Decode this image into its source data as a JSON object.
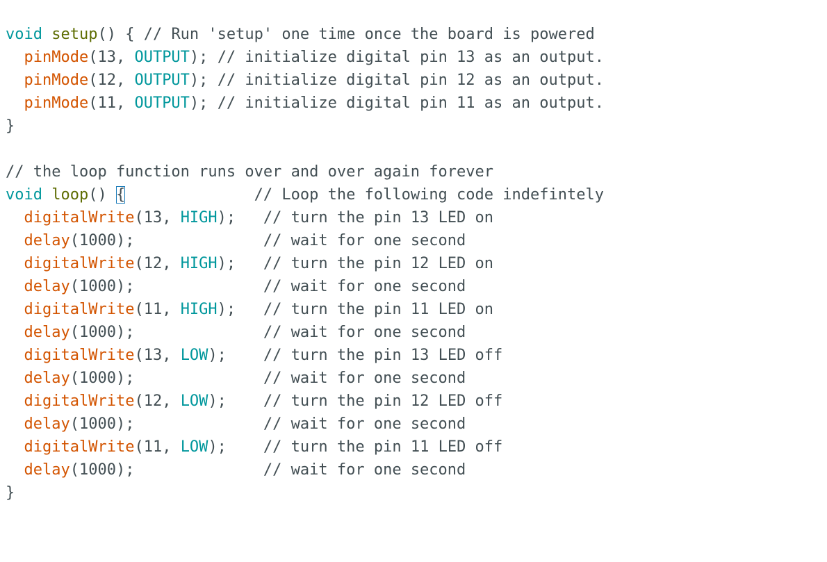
{
  "editor": {
    "lines": [
      {
        "parts": [
          [
            "kw",
            "void"
          ],
          [
            "plain",
            " "
          ],
          [
            "kw2",
            "setup"
          ],
          [
            "plain",
            "() { "
          ],
          [
            "cm",
            "// Run 'setup' one time once the board is powered"
          ]
        ]
      },
      {
        "parts": [
          [
            "plain",
            "  "
          ],
          [
            "fn",
            "pinMode"
          ],
          [
            "plain",
            "(13, "
          ],
          [
            "const",
            "OUTPUT"
          ],
          [
            "plain",
            "); "
          ],
          [
            "cm",
            "// initialize digital pin 13 as an output."
          ]
        ]
      },
      {
        "parts": [
          [
            "plain",
            "  "
          ],
          [
            "fn",
            "pinMode"
          ],
          [
            "plain",
            "(12, "
          ],
          [
            "const",
            "OUTPUT"
          ],
          [
            "plain",
            "); "
          ],
          [
            "cm",
            "// initialize digital pin 12 as an output."
          ]
        ]
      },
      {
        "parts": [
          [
            "plain",
            "  "
          ],
          [
            "fn",
            "pinMode"
          ],
          [
            "plain",
            "(11, "
          ],
          [
            "const",
            "OUTPUT"
          ],
          [
            "plain",
            "); "
          ],
          [
            "cm",
            "// initialize digital pin 11 as an output."
          ]
        ]
      },
      {
        "parts": [
          [
            "plain",
            "}"
          ]
        ]
      },
      {
        "parts": [
          [
            "plain",
            ""
          ]
        ]
      },
      {
        "parts": [
          [
            "cm",
            "// the loop function runs over and over again forever"
          ]
        ]
      },
      {
        "parts": [
          [
            "kw",
            "void"
          ],
          [
            "plain",
            " "
          ],
          [
            "kw2",
            "loop"
          ],
          [
            "plain",
            "() "
          ],
          [
            "brace",
            "{"
          ],
          [
            "plain",
            "              "
          ],
          [
            "cm",
            "// Loop the following code indefintely"
          ]
        ]
      },
      {
        "parts": [
          [
            "plain",
            "  "
          ],
          [
            "fn",
            "digitalWrite"
          ],
          [
            "plain",
            "(13, "
          ],
          [
            "const",
            "HIGH"
          ],
          [
            "plain",
            ");   "
          ],
          [
            "cm",
            "// turn the pin 13 LED on"
          ]
        ]
      },
      {
        "parts": [
          [
            "plain",
            "  "
          ],
          [
            "fn",
            "delay"
          ],
          [
            "plain",
            "(1000);              "
          ],
          [
            "cm",
            "// wait for one second"
          ]
        ]
      },
      {
        "parts": [
          [
            "plain",
            "  "
          ],
          [
            "fn",
            "digitalWrite"
          ],
          [
            "plain",
            "(12, "
          ],
          [
            "const",
            "HIGH"
          ],
          [
            "plain",
            ");   "
          ],
          [
            "cm",
            "// turn the pin 12 LED on"
          ]
        ]
      },
      {
        "parts": [
          [
            "plain",
            "  "
          ],
          [
            "fn",
            "delay"
          ],
          [
            "plain",
            "(1000);              "
          ],
          [
            "cm",
            "// wait for one second"
          ]
        ]
      },
      {
        "parts": [
          [
            "plain",
            "  "
          ],
          [
            "fn",
            "digitalWrite"
          ],
          [
            "plain",
            "(11, "
          ],
          [
            "const",
            "HIGH"
          ],
          [
            "plain",
            ");   "
          ],
          [
            "cm",
            "// turn the pin 11 LED on"
          ]
        ]
      },
      {
        "parts": [
          [
            "plain",
            "  "
          ],
          [
            "fn",
            "delay"
          ],
          [
            "plain",
            "(1000);              "
          ],
          [
            "cm",
            "// wait for one second"
          ]
        ]
      },
      {
        "parts": [
          [
            "plain",
            "  "
          ],
          [
            "fn",
            "digitalWrite"
          ],
          [
            "plain",
            "(13, "
          ],
          [
            "const",
            "LOW"
          ],
          [
            "plain",
            ");    "
          ],
          [
            "cm",
            "// turn the pin 13 LED off"
          ]
        ]
      },
      {
        "parts": [
          [
            "plain",
            "  "
          ],
          [
            "fn",
            "delay"
          ],
          [
            "plain",
            "(1000);              "
          ],
          [
            "cm",
            "// wait for one second"
          ]
        ]
      },
      {
        "parts": [
          [
            "plain",
            "  "
          ],
          [
            "fn",
            "digitalWrite"
          ],
          [
            "plain",
            "(12, "
          ],
          [
            "const",
            "LOW"
          ],
          [
            "plain",
            ");    "
          ],
          [
            "cm",
            "// turn the pin 12 LED off"
          ]
        ]
      },
      {
        "parts": [
          [
            "plain",
            "  "
          ],
          [
            "fn",
            "delay"
          ],
          [
            "plain",
            "(1000);              "
          ],
          [
            "cm",
            "// wait for one second"
          ]
        ]
      },
      {
        "parts": [
          [
            "plain",
            "  "
          ],
          [
            "fn",
            "digitalWrite"
          ],
          [
            "plain",
            "(11, "
          ],
          [
            "const",
            "LOW"
          ],
          [
            "plain",
            ");    "
          ],
          [
            "cm",
            "// turn the pin 11 LED off"
          ]
        ]
      },
      {
        "parts": [
          [
            "plain",
            "  "
          ],
          [
            "fn",
            "delay"
          ],
          [
            "plain",
            "(1000);              "
          ],
          [
            "cm",
            "// wait for one second"
          ]
        ]
      },
      {
        "parts": [
          [
            "plain",
            "}"
          ]
        ]
      }
    ]
  },
  "colors": {
    "background": "#ffffff",
    "keyword": "#00979c",
    "function_name": "#5e6d03",
    "builtin": "#d35400",
    "constant": "#00979c",
    "text": "#434f54",
    "brace_match_outline": "#1a7bb9"
  }
}
